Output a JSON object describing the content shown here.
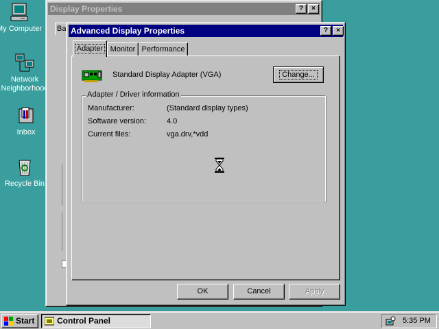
{
  "desktop": {
    "icons": [
      {
        "label": "My Computer",
        "icon": "my-computer-icon"
      },
      {
        "label": "Network Neighborhood",
        "label_line1": "Network",
        "label_line2": "Neighborhood",
        "icon": "network-neighborhood-icon"
      },
      {
        "label": "Inbox",
        "icon": "inbox-icon"
      },
      {
        "label": "Recycle Bin",
        "icon": "recycle-bin-icon"
      }
    ],
    "background_color": "#3a9e9e"
  },
  "background_window": {
    "title": "Display Properties",
    "tab_stub": "Ba",
    "help_button": "?",
    "close_button": "×"
  },
  "dialog": {
    "title": "Advanced Display Properties",
    "help_button": "?",
    "close_button": "×",
    "tabs": [
      {
        "label": "Adapter",
        "active": true
      },
      {
        "label": "Monitor",
        "active": false
      },
      {
        "label": "Performance",
        "active": false
      }
    ],
    "adapter_name": "Standard Display Adapter (VGA)",
    "change_button": "Change...",
    "group_title": "Adapter / Driver information",
    "info": [
      {
        "label": "Manufacturer:",
        "value": "(Standard display types)"
      },
      {
        "label": "Software version:",
        "value": "4.0"
      },
      {
        "label": "Current files:",
        "value": "vga.drv,*vdd"
      }
    ],
    "buttons": {
      "ok": "OK",
      "cancel": "Cancel",
      "apply": "Apply"
    },
    "title_bar_color": "#000080"
  },
  "cursor": "hourglass-icon",
  "taskbar": {
    "start_label": "Start",
    "tasks": [
      {
        "label": "Control Panel",
        "active": true
      }
    ],
    "clock": "5:35 PM"
  }
}
